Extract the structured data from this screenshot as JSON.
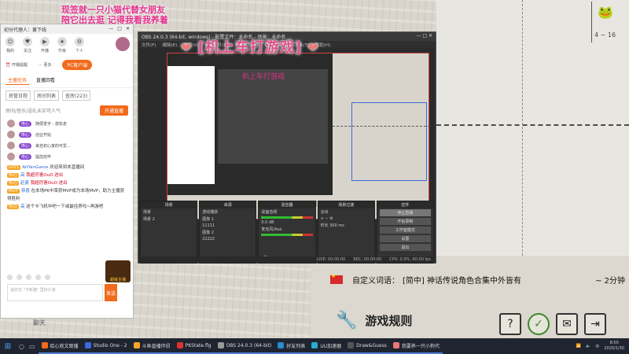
{
  "banner": {
    "line1": "现签就一只小猫代替女朋友",
    "line2": "陪它出去逛 记得我看我养着"
  },
  "game": {
    "word_lang": "自定义词语：",
    "word_text": "[简中] 神话传说角色合集中外皆有",
    "time": "~ 2分钟",
    "rules": "游戏规则",
    "page": "4 ~ 16"
  },
  "live_panel": {
    "title": "初分代理人：黄下线",
    "top_icons": [
      "我的",
      "关注",
      "开播",
      "升级",
      "个人"
    ],
    "row2": [
      "开播提醒",
      "更多"
    ],
    "pc_button": "PC客户端",
    "tabs": [
      "主播任务",
      "直播回看"
    ],
    "subtabs": [
      "房管日程",
      "房间列表",
      "查房(223)"
    ],
    "note": "房间/音乐/送礼未实可人气",
    "join_button": "开通直播",
    "fans": [
      {
        "badge": "传心",
        "text": "随便发字 - 放松走"
      },
      {
        "badge": "传心",
        "text": "创业开始"
      },
      {
        "badge": "传心",
        "text": "来自初心家的可爱..."
      },
      {
        "badge": "传心",
        "text": "提前完毕"
      }
    ],
    "chat": [
      {
        "badge": "LV21",
        "name": "AltYanGame",
        "text": "欢迎来到本直播间"
      },
      {
        "badge": "传心",
        "name": "高",
        "text": "我超厉害OuO 进出"
      },
      {
        "badge": "传心",
        "name": "赶紧",
        "text": "我超厉害OuO 进出"
      },
      {
        "badge": "MVP",
        "name": "恭喜",
        "text": "在本场PK中荣获MVP成为本场MVP，助力主播获得胜利"
      },
      {
        "badge": "传心",
        "name": "高",
        "text": "这个卡飞机中吧一下或最佳房吗~再游吧"
      }
    ],
    "input_placeholder": "说好在 \"卡斯猫\" 里好久家",
    "send": "发送",
    "chat_label": "聊天",
    "badge_text": "超级主播"
  },
  "obs": {
    "title": "OBS 24.0.3 (64-bit, windows) - 配置文件：未命名 - 场景：未命名",
    "menu": [
      "文件(F)",
      "编辑(E)",
      "视图(V)",
      "停靠部件(D)",
      "配置文件(P)",
      "场景集合(S)",
      "工具(T)",
      "帮助(H)"
    ],
    "overlay_title": "[机上车打游戏]",
    "mini_title": "机上车打游戏",
    "docks": {
      "scenes": {
        "header": "场景",
        "items": [
          "场景",
          "场景 2"
        ]
      },
      "sources": {
        "header": "来源",
        "items": [
          "游戏捕获",
          "图像 1",
          "11111",
          "图像 2",
          "22222"
        ]
      },
      "mixer": {
        "header": "混音器",
        "items": [
          "桌面音频",
          "麦克风/Aux"
        ],
        "level": "0.0 dB"
      },
      "transitions": {
        "header": "场景过渡",
        "items": [
          "淡出"
        ],
        "duration_label": "时长",
        "duration": "300 ms"
      },
      "controls": {
        "header": "控件",
        "buttons": [
          "停止直播",
          "开始录制",
          "工作室模式",
          "设置",
          "退出"
        ]
      }
    },
    "status": [
      "LIVE: 00:00:00",
      "REC: 00:00:00",
      "CPU: 0.9%, 60.00 fps"
    ]
  },
  "taskbar": {
    "apps": [
      "给心就文观播",
      "Studio One - 2",
      "斗鱼直播伴侣",
      "PKState.flg",
      "OBS 24.0.3 (64-bit)",
      "好友列表",
      "UU加速器",
      "Draw&Guess",
      "我要养一只小狗代"
    ],
    "time": "8:50",
    "date": "2020/1/30",
    "lang": "中"
  }
}
